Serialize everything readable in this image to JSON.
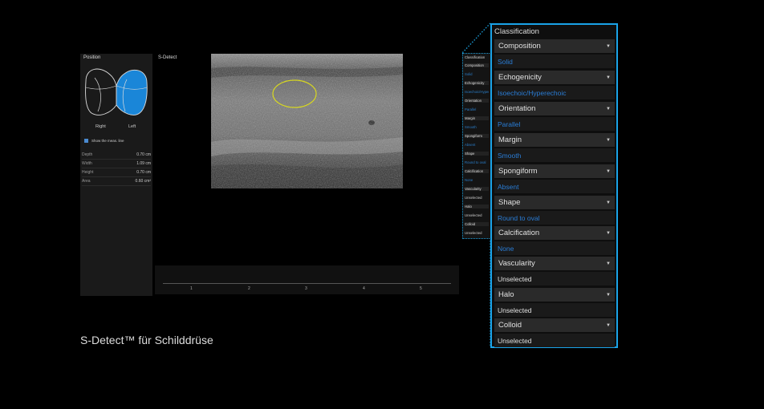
{
  "position_panel": {
    "title": "Position",
    "right_label": "Right",
    "left_label": "Left",
    "show_meas_line": "Show the meas. line",
    "measurements": [
      {
        "label": "Depth",
        "value": "0.70 cm"
      },
      {
        "label": "Width",
        "value": "1.09 cm"
      },
      {
        "label": "Height",
        "value": "0.70 cm"
      },
      {
        "label": "Area",
        "value": "0.60 cm²"
      }
    ],
    "highlight_color": "#1a86d8"
  },
  "sdetect": {
    "label": "S-Detect",
    "scale_ticks": [
      "1",
      "2",
      "3",
      "4",
      "5"
    ],
    "lesion_outline_color": "#d8d820"
  },
  "classification": {
    "title": "Classification",
    "items": [
      {
        "name": "Composition",
        "value": "Solid",
        "selected": true
      },
      {
        "name": "Echogenicity",
        "value": "Isoechoic/Hyperechoic",
        "selected": true
      },
      {
        "name": "Orientation",
        "value": "Parallel",
        "selected": true
      },
      {
        "name": "Margin",
        "value": "Smooth",
        "selected": true
      },
      {
        "name": "Spongiform",
        "value": "Absent",
        "selected": true
      },
      {
        "name": "Shape",
        "value": "Round to oval",
        "selected": true
      },
      {
        "name": "Calcification",
        "value": "None",
        "selected": true
      },
      {
        "name": "Vascularity",
        "value": "Unselected",
        "selected": false
      },
      {
        "name": "Halo",
        "value": "Unselected",
        "selected": false
      },
      {
        "name": "Colloid",
        "value": "Unselected",
        "selected": false
      }
    ],
    "accent_color": "#1aa3e8",
    "icon": "chevron-down-icon"
  },
  "caption": "S-Detect™ für Schilddrüse"
}
